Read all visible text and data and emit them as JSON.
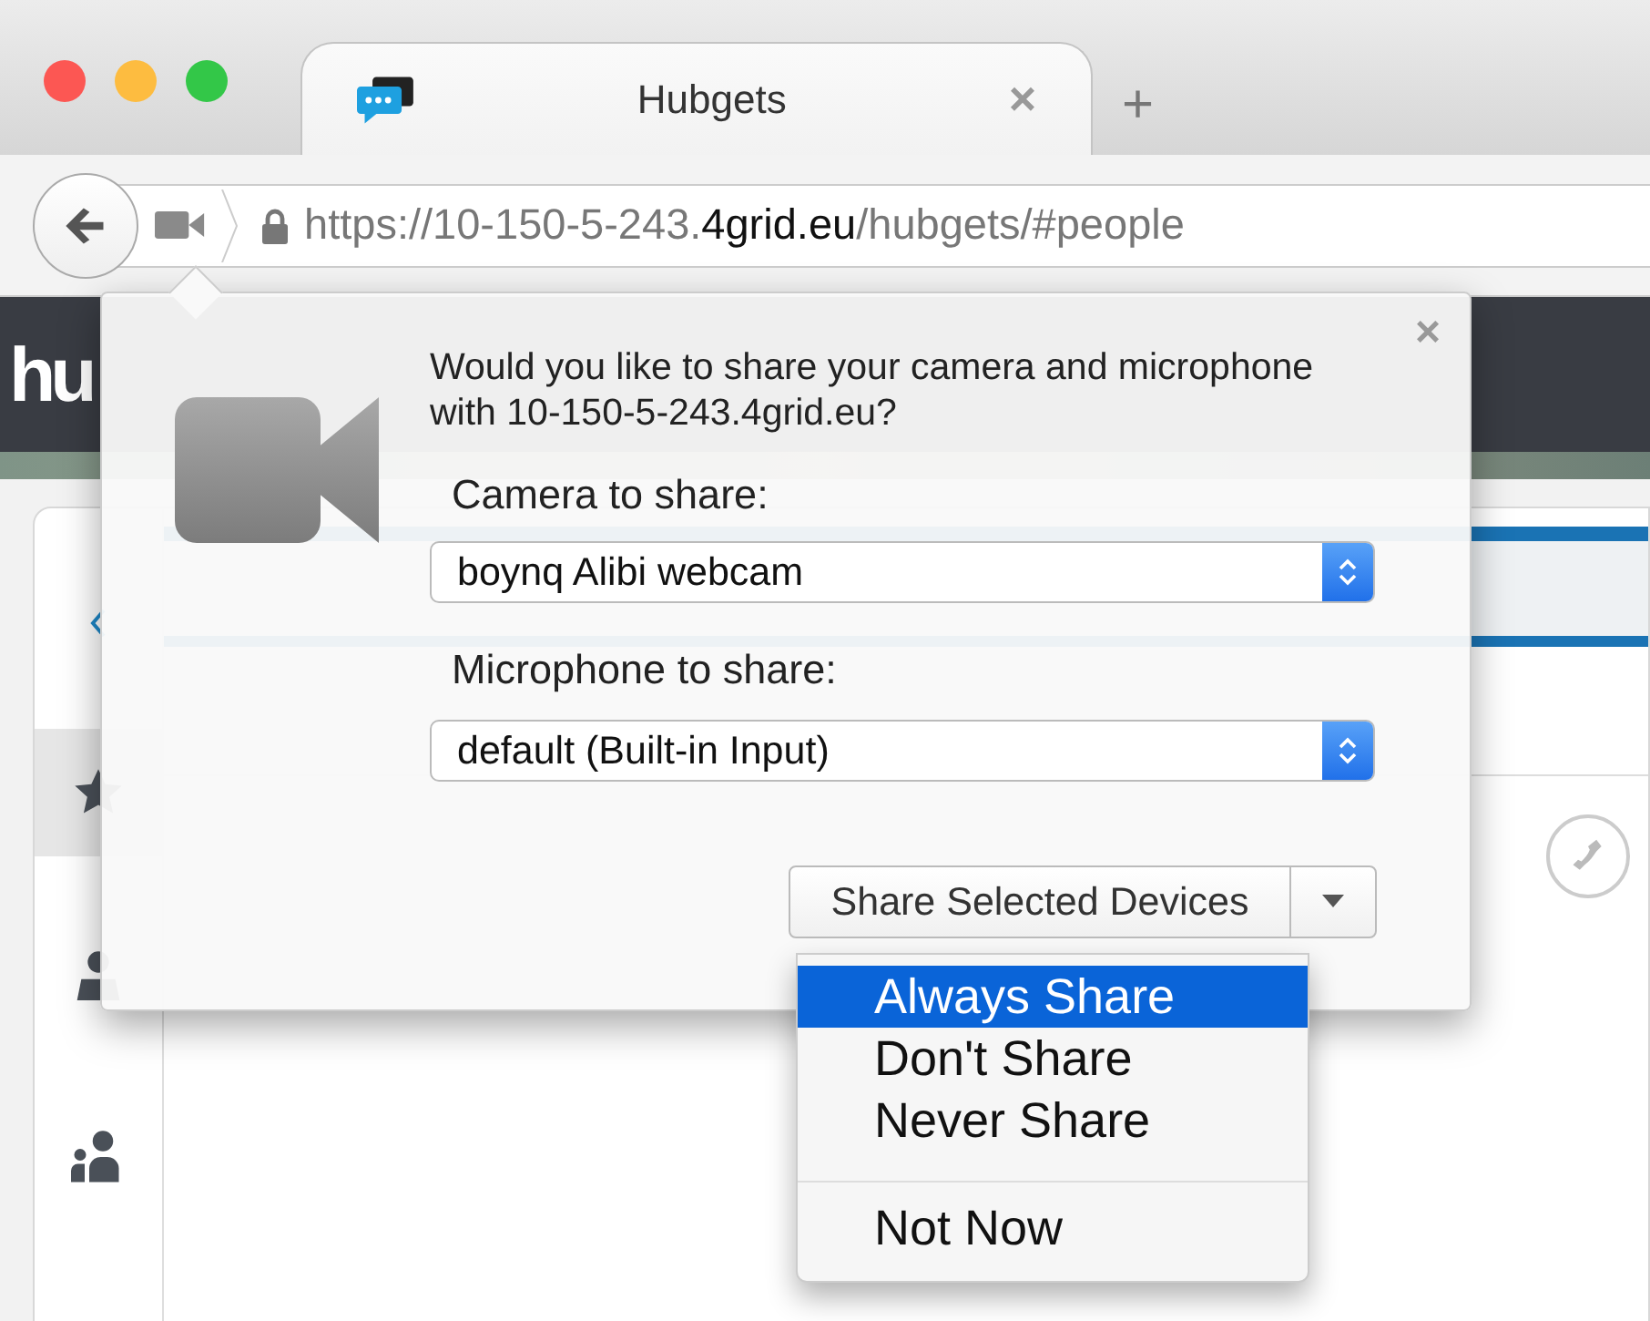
{
  "browser": {
    "tab": {
      "title": "Hubgets",
      "close": "×"
    },
    "new_tab": "+",
    "url": {
      "prefix": "https://10-150-5-243.",
      "domain": "4grid.eu",
      "path": "/hubgets/#people"
    }
  },
  "page": {
    "logo": "hu",
    "sidebar": [
      {
        "kind": "star",
        "selected": true
      },
      {
        "kind": "person",
        "selected": false
      },
      {
        "kind": "group",
        "selected": false
      }
    ]
  },
  "dialog": {
    "close": "×",
    "message": "Would you like to share your camera and microphone with 10-150-5-243.4grid.eu?",
    "camera_label": "Camera to share:",
    "camera_value": "boynq Alibi webcam",
    "microphone_label": "Microphone to share:",
    "microphone_value": "default (Built-in Input)",
    "share_button": "Share Selected Devices"
  },
  "menu": [
    {
      "label": "Always Share",
      "selected": true,
      "separated": false
    },
    {
      "label": "Don't Share",
      "selected": false,
      "separated": false
    },
    {
      "label": "Never Share",
      "selected": false,
      "separated": false
    },
    {
      "label": "Not Now",
      "selected": false,
      "separated": true
    }
  ]
}
